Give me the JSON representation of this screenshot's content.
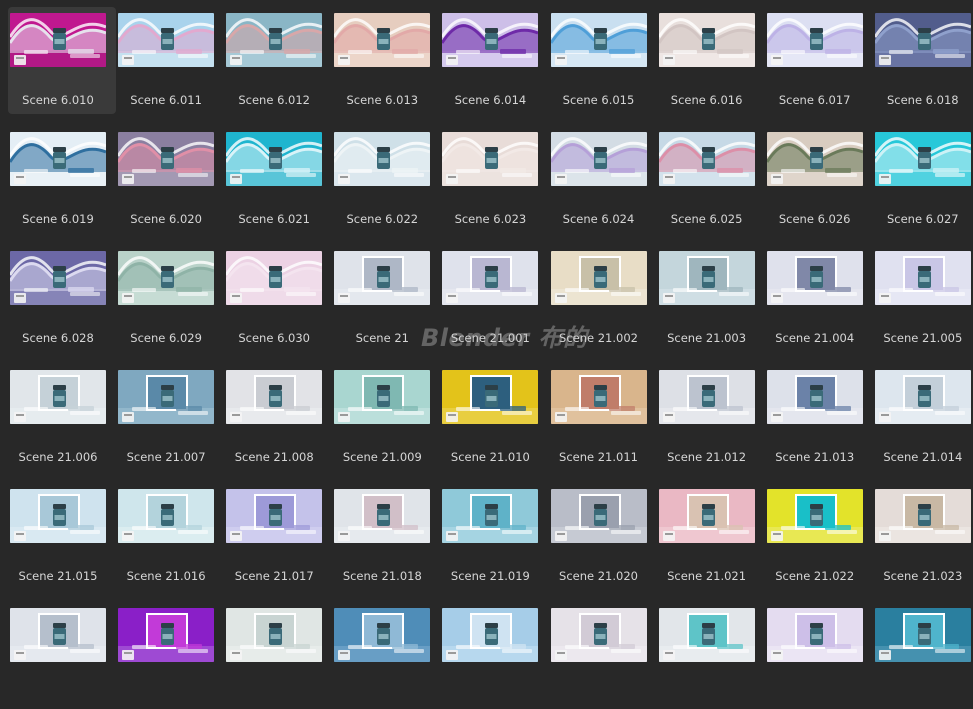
{
  "watermark": "Blender 布的",
  "selected_index": 0,
  "scenes": [
    {
      "label": "Scene 6.010",
      "type": "wave",
      "bg": "#c0188f",
      "accent": "#e6e2ec",
      "base": "#b01985"
    },
    {
      "label": "Scene 6.011",
      "type": "wave",
      "bg": "#a9d3ec",
      "accent": "#e2a9cf",
      "base": "#c8e2f1"
    },
    {
      "label": "Scene 6.012",
      "type": "wave",
      "bg": "#8ab6c6",
      "accent": "#d8a7a9",
      "base": "#a8cbd7"
    },
    {
      "label": "Scene 6.013",
      "type": "wave",
      "bg": "#e6cdbf",
      "accent": "#e2a9a8",
      "base": "#ecd6ca"
    },
    {
      "label": "Scene 6.014",
      "type": "wave",
      "bg": "#cdbfe8",
      "accent": "#6e2aa8",
      "base": "#d6cbee"
    },
    {
      "label": "Scene 6.015",
      "type": "wave",
      "bg": "#c9dff0",
      "accent": "#4f9fd8",
      "base": "#d7e8f4"
    },
    {
      "label": "Scene 6.016",
      "type": "wave",
      "bg": "#e8dfdc",
      "accent": "#d2c5c3",
      "base": "#efe8e6"
    },
    {
      "label": "Scene 6.017",
      "type": "wave",
      "bg": "#dcdff2",
      "accent": "#bdb2e6",
      "base": "#e6e8f6"
    },
    {
      "label": "Scene 6.018",
      "type": "wave",
      "bg": "#525d8c",
      "accent": "#8fa0cc",
      "base": "#6b77a6"
    },
    {
      "label": "Scene 6.019",
      "type": "wave",
      "bg": "#e4eef5",
      "accent": "#2f6f9f",
      "base": "#e9f1f6"
    },
    {
      "label": "Scene 6.020",
      "type": "wave",
      "bg": "#8b7fa0",
      "accent": "#e08fa7",
      "base": "#a59cb5"
    },
    {
      "label": "Scene 6.021",
      "type": "wave",
      "bg": "#1fb5cf",
      "accent": "#d9f3f8",
      "base": "#5fc6d8"
    },
    {
      "label": "Scene 6.022",
      "type": "wave",
      "bg": "#cfe0e8",
      "accent": "#eef4f6",
      "base": "#dce8ee"
    },
    {
      "label": "Scene 6.023",
      "type": "wave",
      "bg": "#e8dcd8",
      "accent": "#f2e9e6",
      "base": "#ece3e0"
    },
    {
      "label": "Scene 6.024",
      "type": "wave",
      "bg": "#d3dce4",
      "accent": "#b5a0d8",
      "base": "#dde4ea"
    },
    {
      "label": "Scene 6.025",
      "type": "wave",
      "bg": "#c6d9e6",
      "accent": "#dc8fa8",
      "base": "#d4e2ec"
    },
    {
      "label": "Scene 6.026",
      "type": "wave",
      "bg": "#d8ccc0",
      "accent": "#6a7a5a",
      "base": "#e0d6cc"
    },
    {
      "label": "Scene 6.027",
      "type": "wave",
      "bg": "#27c8d9",
      "accent": "#cdf2f6",
      "base": "#55d3e0"
    },
    {
      "label": "Scene 6.028",
      "type": "wave",
      "bg": "#6c68a6",
      "accent": "#dcdaf0",
      "base": "#8a87b9"
    },
    {
      "label": "Scene 6.029",
      "type": "wave",
      "bg": "#b9d2c9",
      "accent": "#8fb3a7",
      "base": "#c8ddd5"
    },
    {
      "label": "Scene 6.030",
      "type": "wave",
      "bg": "#ecd2e4",
      "accent": "#f4e4ef",
      "base": "#efdbe9"
    },
    {
      "label": "Scene 21",
      "type": "frame",
      "bg": "#dfe3ea",
      "accent": "#aeb7c6",
      "base": "#e4e8ee"
    },
    {
      "label": "Scene 21.001",
      "type": "frame",
      "bg": "#dfe2ec",
      "accent": "#b9b7d2",
      "base": "#e6e8f0"
    },
    {
      "label": "Scene 21.002",
      "type": "frame",
      "bg": "#e8ddc6",
      "accent": "#c8c0a8",
      "base": "#ece4d2"
    },
    {
      "label": "Scene 21.003",
      "type": "frame",
      "bg": "#c4d6dc",
      "accent": "#9fb6be",
      "base": "#d0dfe4"
    },
    {
      "label": "Scene 21.004",
      "type": "frame",
      "bg": "#dfe1ec",
      "accent": "#8088a8",
      "base": "#e5e7ef"
    },
    {
      "label": "Scene 21.005",
      "type": "frame",
      "bg": "#e0e1f0",
      "accent": "#c9c6e6",
      "base": "#e7e8f4"
    },
    {
      "label": "Scene 21.006",
      "type": "frame",
      "bg": "#e1e6ea",
      "accent": "#c5d1d8",
      "base": "#e7ecef"
    },
    {
      "label": "Scene 21.007",
      "type": "frame",
      "bg": "#7fa8c0",
      "accent": "#5a89a8",
      "base": "#95b8cc"
    },
    {
      "label": "Scene 21.008",
      "type": "frame",
      "bg": "#e2e3e7",
      "accent": "#c9ccd2",
      "base": "#e9eaed"
    },
    {
      "label": "Scene 21.009",
      "type": "frame",
      "bg": "#a9d6d0",
      "accent": "#7fb8b2",
      "base": "#bde0db"
    },
    {
      "label": "Scene 21.010",
      "type": "frame",
      "bg": "#e3c31a",
      "accent": "#2d5f7e",
      "base": "#e8cf45"
    },
    {
      "label": "Scene 21.011",
      "type": "frame",
      "bg": "#d9b58c",
      "accent": "#c07d6a",
      "base": "#e0c29f"
    },
    {
      "label": "Scene 21.012",
      "type": "frame",
      "bg": "#dde0e6",
      "accent": "#bcc3cf",
      "base": "#e5e8ec"
    },
    {
      "label": "Scene 21.013",
      "type": "frame",
      "bg": "#dde1ea",
      "accent": "#6b82a8",
      "base": "#e4e7ee"
    },
    {
      "label": "Scene 21.014",
      "type": "frame",
      "bg": "#dde6ee",
      "accent": "#c3cfd9",
      "base": "#e5ecf2"
    },
    {
      "label": "Scene 21.015",
      "type": "frame",
      "bg": "#cfe3ee",
      "accent": "#a8c8d8",
      "base": "#d9e9f2"
    },
    {
      "label": "Scene 21.016",
      "type": "frame",
      "bg": "#cfe6ec",
      "accent": "#b3d3dc",
      "base": "#dbedf1"
    },
    {
      "label": "Scene 21.017",
      "type": "frame",
      "bg": "#c4c2ea",
      "accent": "#9d9ad8",
      "base": "#d0cef0"
    },
    {
      "label": "Scene 21.018",
      "type": "frame",
      "bg": "#e0e4e9",
      "accent": "#d1bfc8",
      "base": "#e7eaee"
    },
    {
      "label": "Scene 21.019",
      "type": "frame",
      "bg": "#8fc9d9",
      "accent": "#5fb2c8",
      "base": "#a7d5e2"
    },
    {
      "label": "Scene 21.020",
      "type": "frame",
      "bg": "#b9bdc8",
      "accent": "#9aa0ae",
      "base": "#c8cbd4"
    },
    {
      "label": "Scene 21.021",
      "type": "frame",
      "bg": "#eab8c4",
      "accent": "#d9c2b2",
      "base": "#f0c9d2"
    },
    {
      "label": "Scene 21.022",
      "type": "frame",
      "bg": "#e3e32a",
      "accent": "#19bfc8",
      "base": "#e8e858"
    },
    {
      "label": "Scene 21.023",
      "type": "frame",
      "bg": "#e4dcd8",
      "accent": "#c8b8a4",
      "base": "#ebe5e2"
    },
    {
      "label": "",
      "type": "frame",
      "bg": "#dfe3ea",
      "accent": "#b5bfcc",
      "base": "#e6e9ef"
    },
    {
      "label": "",
      "type": "frame",
      "bg": "#8a1fc8",
      "accent": "#c23ad8",
      "base": "#a04fd4"
    },
    {
      "label": "",
      "type": "frame",
      "bg": "#e0e6e4",
      "accent": "#c8d4d2",
      "base": "#e8ecea"
    },
    {
      "label": "",
      "type": "frame",
      "bg": "#4f8db8",
      "accent": "#8fb9d6",
      "base": "#6aa0c6"
    },
    {
      "label": "",
      "type": "frame",
      "bg": "#a6cde8",
      "accent": "#cfe3f2",
      "base": "#b9d9ee"
    },
    {
      "label": "",
      "type": "frame",
      "bg": "#e6e2e8",
      "accent": "#d2cbd6",
      "base": "#ece9ee"
    },
    {
      "label": "",
      "type": "frame",
      "bg": "#e2e6ea",
      "accent": "#5ec4c8",
      "base": "#e9ecef"
    },
    {
      "label": "",
      "type": "frame",
      "bg": "#e4dcf0",
      "accent": "#cdbfe8",
      "base": "#ebe6f4"
    },
    {
      "label": "",
      "type": "frame",
      "bg": "#2a7f9f",
      "accent": "#4fb4cc",
      "base": "#4894b0"
    }
  ]
}
